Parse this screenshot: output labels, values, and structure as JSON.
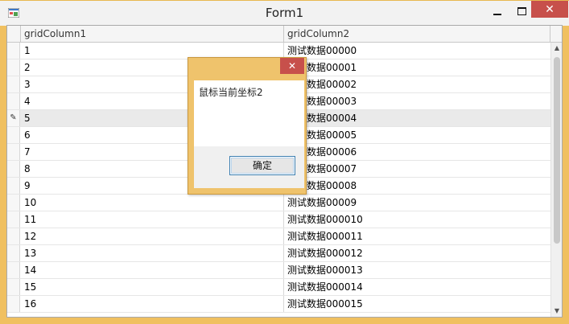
{
  "window": {
    "title": "Form1",
    "controls": {
      "minimize": "minimize",
      "maximize": "maximize",
      "close": "✕"
    }
  },
  "grid": {
    "columns": [
      "gridColumn1",
      "gridColumn2"
    ],
    "focused_row_index": 4,
    "rows": [
      {
        "c1": "1",
        "c2": "测试数据00000"
      },
      {
        "c1": "2",
        "c2": "测试数据00001"
      },
      {
        "c1": "3",
        "c2": "测试数据00002"
      },
      {
        "c1": "4",
        "c2": "测试数据00003"
      },
      {
        "c1": "5",
        "c2": "测试数据00004"
      },
      {
        "c1": "6",
        "c2": "测试数据00005"
      },
      {
        "c1": "7",
        "c2": "测试数据00006"
      },
      {
        "c1": "8",
        "c2": "测试数据00007"
      },
      {
        "c1": "9",
        "c2": "测试数据00008"
      },
      {
        "c1": "10",
        "c2": "测试数据00009"
      },
      {
        "c1": "11",
        "c2": "测试数据000010"
      },
      {
        "c1": "12",
        "c2": "测试数据000011"
      },
      {
        "c1": "13",
        "c2": "测试数据000012"
      },
      {
        "c1": "14",
        "c2": "测试数据000013"
      },
      {
        "c1": "15",
        "c2": "测试数据000014"
      },
      {
        "c1": "16",
        "c2": "测试数据000015"
      }
    ],
    "focused_indicator_icon": "edit-pencil-icon"
  },
  "messagebox": {
    "message": "鼠标当前坐标2",
    "ok_label": "确定",
    "close_label": "✕"
  },
  "colors": {
    "window_border": "#f0c060",
    "close_button": "#c7504b",
    "grid_lines": "#e6e6e6"
  }
}
